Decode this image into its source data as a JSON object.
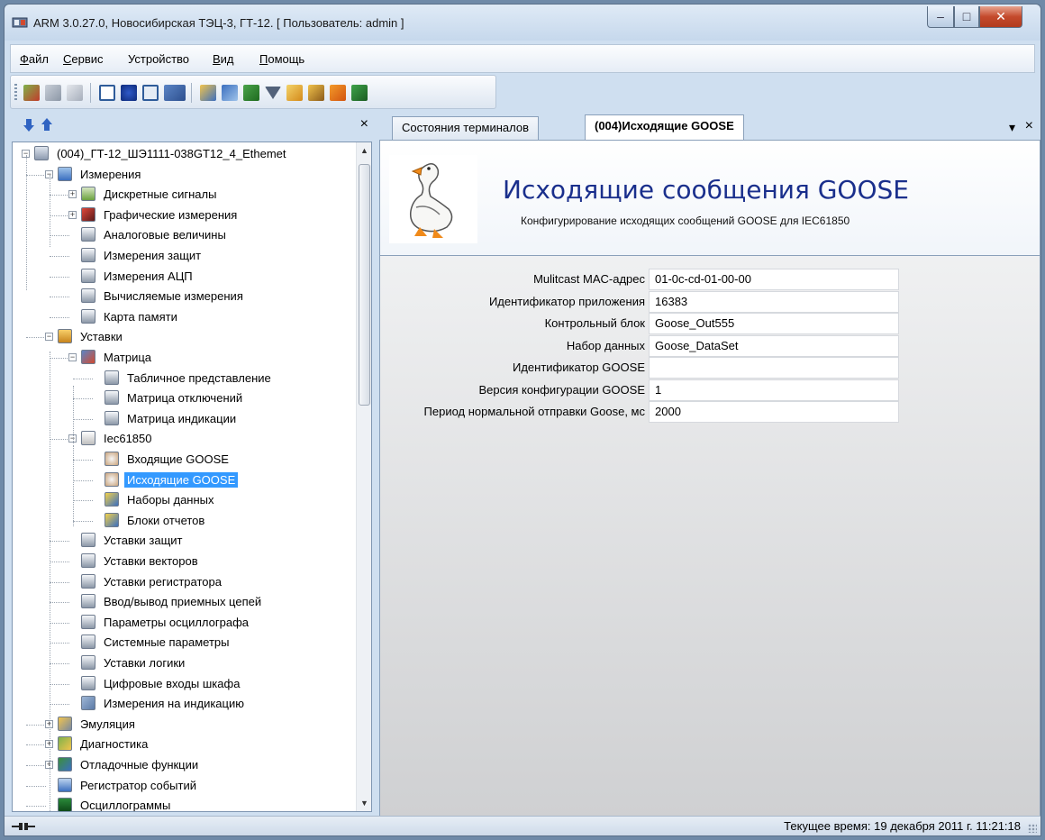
{
  "window": {
    "title": "ARM 3.0.27.0, Новосибирская ТЭЦ-3, ГТ-12. [ Пользователь: admin ]"
  },
  "menu": [
    {
      "label": "Файл",
      "accel": "Ф",
      "rest": "айл"
    },
    {
      "label": "Сервис",
      "accel": "С",
      "rest": "ервис"
    },
    {
      "label": "Устройство",
      "accel": "",
      "rest": "Устройство"
    },
    {
      "label": "Вид",
      "accel": "В",
      "rest": "ид"
    },
    {
      "label": "Помощь",
      "accel": "П",
      "rest": "омощь"
    }
  ],
  "tabs": [
    {
      "label": "Состояния терминалов",
      "active": false
    },
    {
      "label": "(004)Исходящие GOOSE",
      "active": true
    }
  ],
  "tree": [
    {
      "label": "(004)_ГТ-12_ШЭ1111-038GT12_4_Ethemet",
      "icon": "device-icon",
      "expander": "−"
    },
    {
      "label": "Измерения",
      "icon": "measurements-folder-icon",
      "expander": "−"
    },
    {
      "label": "Дискретные сигналы",
      "icon": "discrete-grid-icon",
      "expander": "+"
    },
    {
      "label": "Графические измерения",
      "icon": "graph-icon",
      "expander": "+"
    },
    {
      "label": "Аналоговые величины",
      "icon": "table-icon",
      "expander": ""
    },
    {
      "label": "Измерения защит",
      "icon": "table-icon",
      "expander": ""
    },
    {
      "label": "Измерения АЦП",
      "icon": "table-icon",
      "expander": ""
    },
    {
      "label": "Вычисляемые измерения",
      "icon": "table-icon",
      "expander": ""
    },
    {
      "label": "Карта памяти",
      "icon": "table-icon",
      "expander": ""
    },
    {
      "label": "Уставки",
      "icon": "settings-folder-icon",
      "expander": "−"
    },
    {
      "label": "Матрица",
      "icon": "matrix-icon",
      "expander": "−"
    },
    {
      "label": "Табличное представление",
      "icon": "table-icon",
      "expander": ""
    },
    {
      "label": "Матрица отключений",
      "icon": "table-icon",
      "expander": ""
    },
    {
      "label": "Матрица индикации",
      "icon": "table-icon",
      "expander": ""
    },
    {
      "label": "Iec61850",
      "icon": "iec-icon",
      "expander": "−"
    },
    {
      "label": "Входящие GOOSE",
      "icon": "goose-icon",
      "expander": ""
    },
    {
      "label": "Исходящие GOOSE",
      "icon": "goose-icon",
      "expander": "",
      "selected": true
    },
    {
      "label": "Наборы данных",
      "icon": "dataset-icon",
      "expander": ""
    },
    {
      "label": "Блоки отчетов",
      "icon": "dataset-icon",
      "expander": ""
    },
    {
      "label": "Уставки защит",
      "icon": "table-icon",
      "expander": ""
    },
    {
      "label": "Уставки векторов",
      "icon": "table-icon",
      "expander": ""
    },
    {
      "label": "Уставки регистратора",
      "icon": "table-icon",
      "expander": ""
    },
    {
      "label": "Ввод/вывод приемных цепей",
      "icon": "table-icon",
      "expander": ""
    },
    {
      "label": "Параметры осциллографа",
      "icon": "table-icon",
      "expander": ""
    },
    {
      "label": "Системные параметры",
      "icon": "table-icon",
      "expander": ""
    },
    {
      "label": "Уставки логики",
      "icon": "table-icon",
      "expander": ""
    },
    {
      "label": "Цифровые входы шкафа",
      "icon": "table-icon",
      "expander": ""
    },
    {
      "label": "Измерения на индикацию",
      "icon": "indication-icon",
      "expander": ""
    },
    {
      "label": "Эмуляция",
      "icon": "emulation-icon",
      "expander": "+"
    },
    {
      "label": "Диагностика",
      "icon": "diagnostics-icon",
      "expander": "+"
    },
    {
      "label": "Отладочные функции",
      "icon": "debug-icon",
      "expander": "+"
    },
    {
      "label": "Регистратор событий",
      "icon": "events-icon",
      "expander": ""
    },
    {
      "label": "Осциллограммы",
      "icon": "oscillogram-icon",
      "expander": ""
    }
  ],
  "header": {
    "title": "Исходящие сообщения GOOSE",
    "subtitle": "Конфигурирование исходящих сообщений GOOSE для IEC61850"
  },
  "properties": [
    {
      "label": "Mulitcast MAC-адрес",
      "value": "01-0c-cd-01-00-00"
    },
    {
      "label": "Идентификатор приложения",
      "value": "16383"
    },
    {
      "label": "Контрольный блок",
      "value": "Goose_Out555"
    },
    {
      "label": "Набор данных",
      "value": "Goose_DataSet"
    },
    {
      "label": "Идентификатор GOOSE",
      "value": ""
    },
    {
      "label": "Версия конфигурации GOOSE",
      "value": "1"
    },
    {
      "label": "Период нормальной отправки Goose, мс",
      "value": "2000"
    }
  ],
  "status": {
    "current_time": "Текущее время: 19 декабря 2011 г. 11:21:18"
  },
  "panel_controls": {
    "close_glyph": "×",
    "dropdown_glyph": "▾"
  }
}
